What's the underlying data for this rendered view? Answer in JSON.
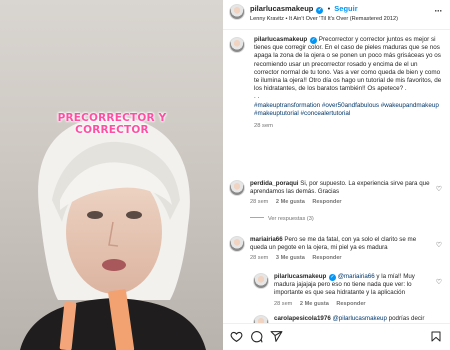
{
  "overlay_text": "PRECORRECTOR Y CORRECTOR",
  "header": {
    "username": "pilarlucasmakeup",
    "follow_label": "Seguir",
    "music": "Lenny Kravitz • It Ain't Over 'Til It's Over (Remastered 2012)"
  },
  "caption": {
    "username": "pilarlucasmakeup",
    "text": "Precorrector y corrector juntos es mejor si tienes que corregir color. En el caso de pieles maduras que se nos apaga la zona de la ojera o se ponen un poco más grisáceas yo os recomiendo usar un precorrector rosado y encima de el un corrector normal de tu tono. Vas a ver como queda de bien y como te ilumina la ojera!! Otro día os hago un tutorial de mis favoritos, de los hidratantes, de los baratos también!! Os apetece? .",
    "dots": ". .",
    "hashtags": "#makeuptransformation #over50andfabulous #wakeupandmakeup #makeuptutorial #concealertutorial",
    "time": "28 sem"
  },
  "comments": [
    {
      "username": "perdida_poraqui",
      "text": "Si, por supuesto. La experiencia sirve para que aprendamos las demás. Gracias",
      "time": "28 sem",
      "likes": "2 Me gusta",
      "reply_label": "Responder",
      "view_replies": "Ver respuestas (3)"
    },
    {
      "username": "mariairia66",
      "text": "Pero se me da fatal, con ya solo el clarito se me queda un pegote en la ojera, mi piel ya es madura",
      "time": "28 sem",
      "likes": "3 Me gusta",
      "reply_label": "Responder"
    }
  ],
  "replies": [
    {
      "username": "pilarlucasmakeup",
      "mention": "@mariairia66",
      "text": "y la mía!! Muy madura jajajaja pero eso no tiene nada que ver: lo importante es que sea hidratante y la aplicación",
      "time": "28 sem",
      "likes": "2 Me gusta",
      "reply_label": "Responder"
    },
    {
      "username": "carolapesicola1976",
      "mention": "@pilarlucasmakeup",
      "text": "podrías decir"
    }
  ],
  "colors": {
    "overlay_pink": "#ff4fa3",
    "link_blue": "#0095f6",
    "hashtag_navy": "#00376b",
    "muted_gray": "#737373"
  }
}
